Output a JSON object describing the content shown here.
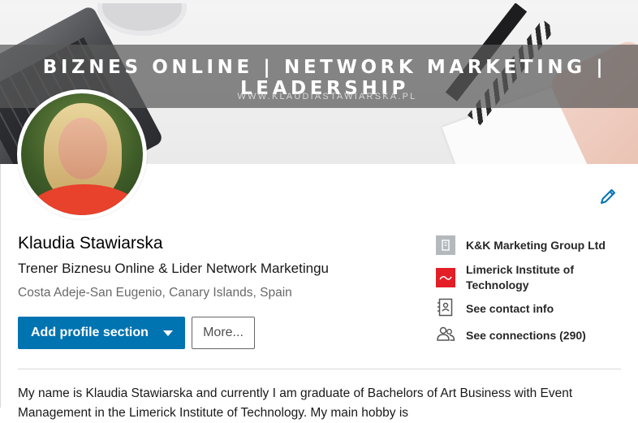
{
  "banner": {
    "headline": "BIZNES ONLINE | NETWORK MARKETING | LEADERSHIP",
    "website": "WWW.KLAUDIASTAWIARSKA.PL"
  },
  "profile": {
    "name": "Klaudia Stawiarska",
    "headline": "Trener Biznesu Online & Lider Network Marketingu",
    "location": "Costa Adeje-San Eugenio, Canary Islands, Spain"
  },
  "actions": {
    "add_section_label": "Add profile section",
    "more_label": "More..."
  },
  "sidebar": {
    "company": "K&K Marketing Group Ltd",
    "school_line1": "Limerick Institute of",
    "school_line2": "Technology",
    "contact_info": "See contact info",
    "connections": "See connections (290)"
  },
  "summary": {
    "line1": "My name is Klaudia Stawiarska and currently I am graduate of Bachelors of Art Business with Event",
    "line2": "Management in the Limerick Institute of Technology. My main hobby is"
  },
  "colors": {
    "primary": "#0073b1",
    "school_logo": "#e41e26"
  },
  "icons": [
    "pencil-icon",
    "building-icon",
    "school-logo-icon",
    "contact-card-icon",
    "people-icon",
    "caret-down-icon"
  ]
}
